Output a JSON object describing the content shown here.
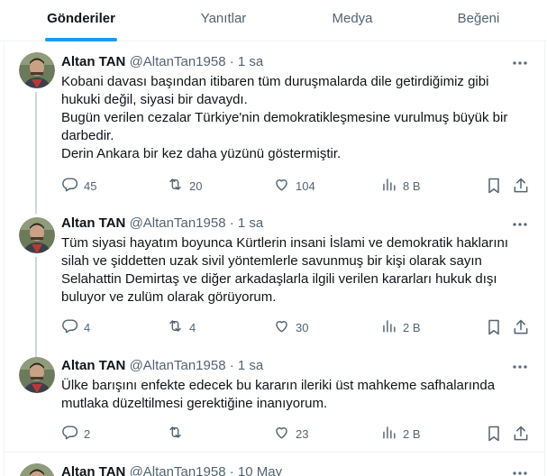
{
  "tabs": [
    {
      "label": "Gönderiler",
      "active": true
    },
    {
      "label": "Yanıtlar",
      "active": false
    },
    {
      "label": "Medya",
      "active": false
    },
    {
      "label": "Beğeni",
      "active": false
    }
  ],
  "accent_color": "#1d9bf0",
  "tweets": [
    {
      "name": "Altan TAN",
      "handle": "@AltanTan1958",
      "dot": "·",
      "time": "1 sa",
      "lines": [
        "Kobani davası başından itibaren tüm duruşmalarda dile getirdiğimiz gibi",
        "hukuki değil, siyasi bir davaydı.",
        "Bugün verilen cezalar Türkiye'nin demokratikleşmesine vurulmuş büyük bir",
        "darbedir.",
        "Derin Ankara bir kez daha yüzünü göstermiştir."
      ],
      "replies": "45",
      "retweets": "20",
      "likes": "104",
      "views": "8 B"
    },
    {
      "name": "Altan TAN",
      "handle": "@AltanTan1958",
      "dot": "·",
      "time": "1 sa",
      "lines": [
        "Tüm siyasi hayatım boyunca Kürtlerin insani  İslami ve demokratik haklarını",
        "silah ve şiddetten uzak sivil yöntemlerle savunmuş bir kişi olarak sayın",
        "Selahattin Demirtaş ve diğer arkadaşlarla ilgili verilen kararları hukuk dışı",
        "buluyor ve zulüm olarak görüyorum."
      ],
      "replies": "4",
      "retweets": "4",
      "likes": "30",
      "views": "2 B"
    },
    {
      "name": "Altan TAN",
      "handle": "@AltanTan1958",
      "dot": "·",
      "time": "1 sa",
      "lines": [
        "Ülke barışını enfekte edecek bu kararın ileriki üst mahkeme safhalarında",
        "mutlaka düzeltilmesi gerektiğine inanıyorum."
      ],
      "replies": "2",
      "retweets": "",
      "likes": "23",
      "views": "2 B"
    },
    {
      "name": "Altan TAN",
      "handle": "@AltanTan1958",
      "dot": "·",
      "time": "10 May",
      "lines": []
    }
  ],
  "icons": {
    "more": "more-horizontal-icon",
    "reply": "reply-icon",
    "retweet": "retweet-icon",
    "like": "heart-icon",
    "views": "views-icon",
    "bookmark": "bookmark-icon",
    "share": "share-icon"
  }
}
